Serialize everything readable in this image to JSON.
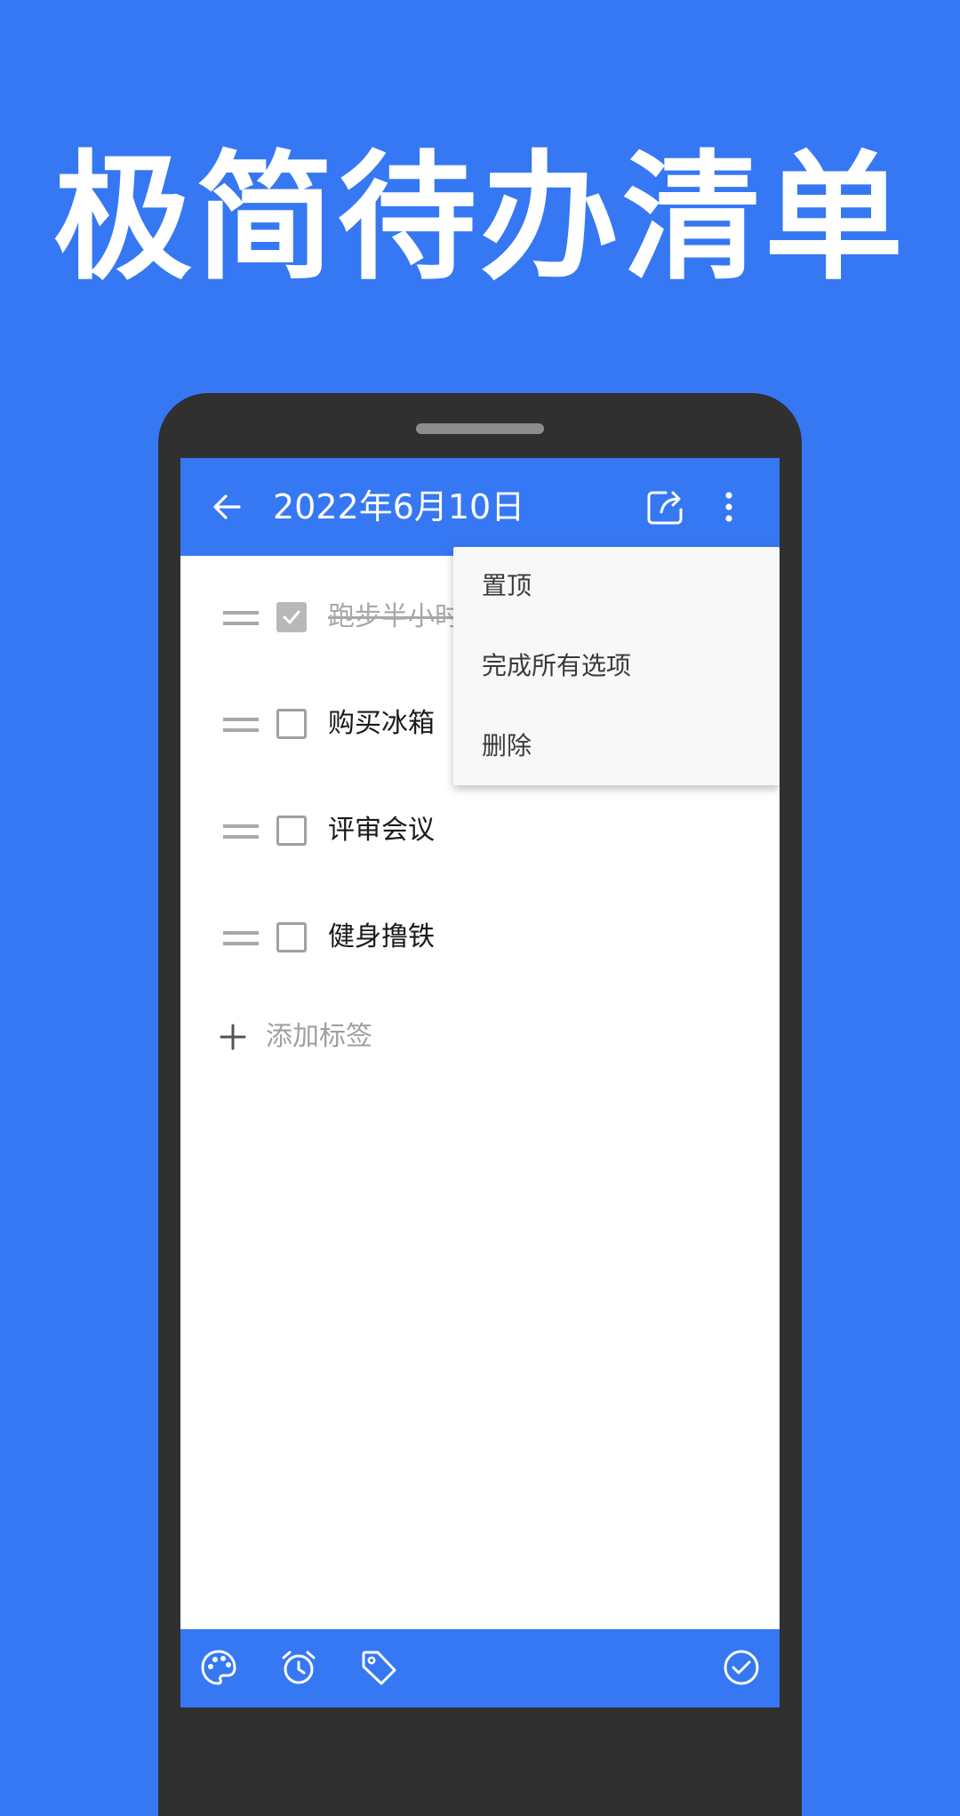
{
  "headline": "极简待办清单",
  "appbar": {
    "title": "2022年6月10日",
    "back_icon": "arrow-left-icon",
    "share_icon": "share-icon",
    "more_icon": "more-vert-icon"
  },
  "todos": [
    {
      "text": "跑步半小时",
      "checked": true
    },
    {
      "text": "购买冰箱",
      "checked": false
    },
    {
      "text": "评审会议",
      "checked": false
    },
    {
      "text": "健身撸铁",
      "checked": false
    }
  ],
  "add_tag": {
    "label": "添加标签",
    "icon": "plus-icon"
  },
  "menu": {
    "items": [
      "置顶",
      "完成所有选项",
      "删除"
    ]
  },
  "bottombar": {
    "icons": [
      "palette-icon",
      "alarm-icon",
      "tag-icon",
      "check-circle-icon"
    ]
  },
  "colors": {
    "background": "#3678F3",
    "primary": "#3678F3",
    "phone_body": "#303030",
    "menu_background": "#F8F8F8",
    "completed_text": "#A8A8A8"
  }
}
